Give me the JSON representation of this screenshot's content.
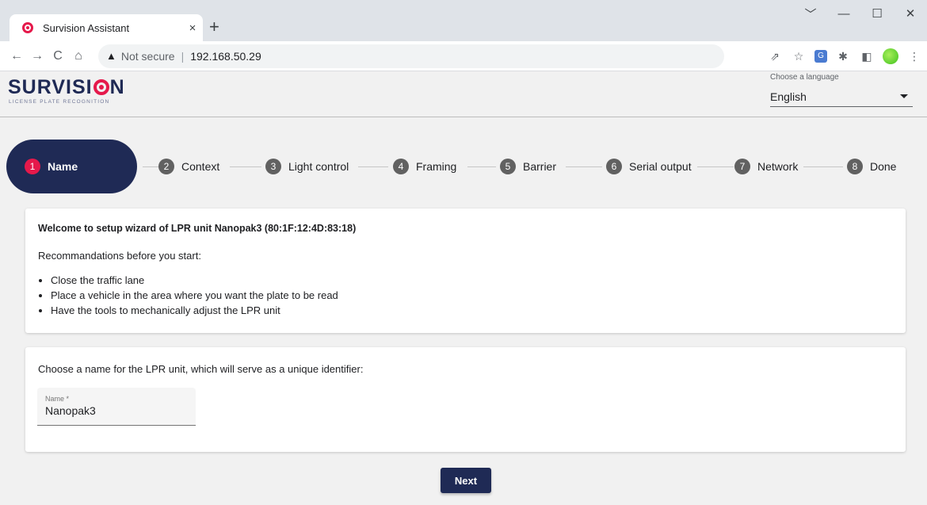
{
  "browser": {
    "tab_title": "Survision Assistant",
    "tab_close": "×",
    "new_tab": "+",
    "window_controls": {
      "dropdown": "﹀",
      "minimize": "—",
      "maximize": "☐",
      "close": "✕"
    },
    "nav": {
      "back": "←",
      "forward": "→",
      "reload": "C",
      "home": "⌂"
    },
    "security_label": "Not secure",
    "separator": "|",
    "url": "192.168.50.29",
    "extension_icons": [
      "share-icon",
      "star-icon",
      "google-translate-icon",
      "puzzle-icon",
      "sidepanel-icon",
      "profile-icon",
      "more-icon"
    ]
  },
  "header": {
    "logo_text_before": "SURVISI",
    "logo_text_after": "N",
    "logo_subtitle": "LICENSE PLATE RECOGNITION",
    "language_label": "Choose a language",
    "language_value": "English"
  },
  "stepper": {
    "steps": [
      {
        "num": "1",
        "label": "Name",
        "active": true
      },
      {
        "num": "2",
        "label": "Context"
      },
      {
        "num": "3",
        "label": "Light control"
      },
      {
        "num": "4",
        "label": "Framing"
      },
      {
        "num": "5",
        "label": "Barrier"
      },
      {
        "num": "6",
        "label": "Serial output"
      },
      {
        "num": "7",
        "label": "Network"
      },
      {
        "num": "8",
        "label": "Done"
      }
    ]
  },
  "welcome_card": {
    "title": "Welcome to setup wizard of LPR unit Nanopak3 (80:1F:12:4D:83:18)",
    "intro": "Recommandations before you start:",
    "items": [
      "Close the traffic lane",
      "Place a vehicle in the area where you want the plate to be read",
      "Have the tools to mechanically adjust the LPR unit"
    ]
  },
  "name_card": {
    "prompt": "Choose a name for the LPR unit, which will serve as a unique identifier:",
    "field_label": "Name *",
    "field_value": "Nanopak3"
  },
  "actions": {
    "next_label": "Next"
  },
  "colors": {
    "brand_navy": "#1f2a55",
    "brand_red": "#e5194b"
  }
}
